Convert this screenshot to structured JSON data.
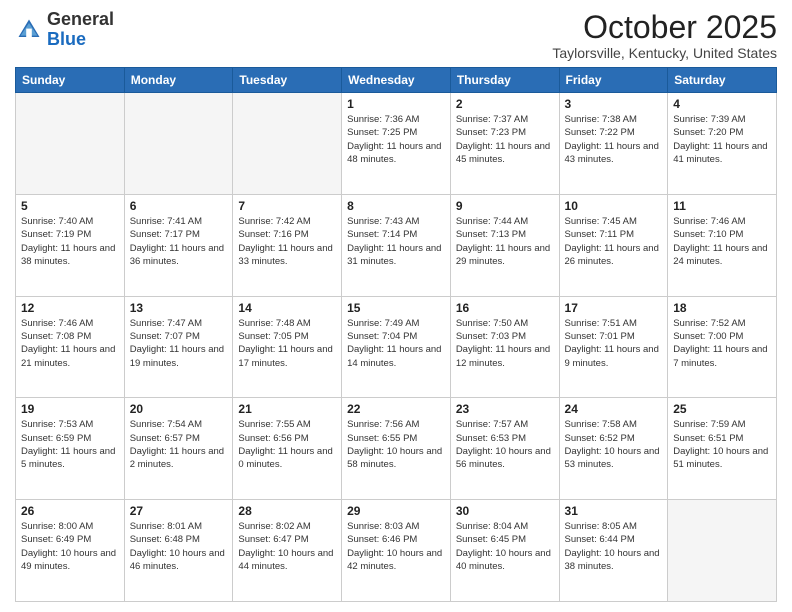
{
  "header": {
    "logo": {
      "general": "General",
      "blue": "Blue"
    },
    "title": "October 2025",
    "location": "Taylorsville, Kentucky, United States"
  },
  "weekdays": [
    "Sunday",
    "Monday",
    "Tuesday",
    "Wednesday",
    "Thursday",
    "Friday",
    "Saturday"
  ],
  "weeks": [
    [
      {
        "day": "",
        "info": "",
        "empty": true
      },
      {
        "day": "",
        "info": "",
        "empty": true
      },
      {
        "day": "",
        "info": "",
        "empty": true
      },
      {
        "day": "1",
        "info": "Sunrise: 7:36 AM\nSunset: 7:25 PM\nDaylight: 11 hours\nand 48 minutes."
      },
      {
        "day": "2",
        "info": "Sunrise: 7:37 AM\nSunset: 7:23 PM\nDaylight: 11 hours\nand 45 minutes."
      },
      {
        "day": "3",
        "info": "Sunrise: 7:38 AM\nSunset: 7:22 PM\nDaylight: 11 hours\nand 43 minutes."
      },
      {
        "day": "4",
        "info": "Sunrise: 7:39 AM\nSunset: 7:20 PM\nDaylight: 11 hours\nand 41 minutes."
      }
    ],
    [
      {
        "day": "5",
        "info": "Sunrise: 7:40 AM\nSunset: 7:19 PM\nDaylight: 11 hours\nand 38 minutes."
      },
      {
        "day": "6",
        "info": "Sunrise: 7:41 AM\nSunset: 7:17 PM\nDaylight: 11 hours\nand 36 minutes."
      },
      {
        "day": "7",
        "info": "Sunrise: 7:42 AM\nSunset: 7:16 PM\nDaylight: 11 hours\nand 33 minutes."
      },
      {
        "day": "8",
        "info": "Sunrise: 7:43 AM\nSunset: 7:14 PM\nDaylight: 11 hours\nand 31 minutes."
      },
      {
        "day": "9",
        "info": "Sunrise: 7:44 AM\nSunset: 7:13 PM\nDaylight: 11 hours\nand 29 minutes."
      },
      {
        "day": "10",
        "info": "Sunrise: 7:45 AM\nSunset: 7:11 PM\nDaylight: 11 hours\nand 26 minutes."
      },
      {
        "day": "11",
        "info": "Sunrise: 7:46 AM\nSunset: 7:10 PM\nDaylight: 11 hours\nand 24 minutes."
      }
    ],
    [
      {
        "day": "12",
        "info": "Sunrise: 7:46 AM\nSunset: 7:08 PM\nDaylight: 11 hours\nand 21 minutes."
      },
      {
        "day": "13",
        "info": "Sunrise: 7:47 AM\nSunset: 7:07 PM\nDaylight: 11 hours\nand 19 minutes."
      },
      {
        "day": "14",
        "info": "Sunrise: 7:48 AM\nSunset: 7:05 PM\nDaylight: 11 hours\nand 17 minutes."
      },
      {
        "day": "15",
        "info": "Sunrise: 7:49 AM\nSunset: 7:04 PM\nDaylight: 11 hours\nand 14 minutes."
      },
      {
        "day": "16",
        "info": "Sunrise: 7:50 AM\nSunset: 7:03 PM\nDaylight: 11 hours\nand 12 minutes."
      },
      {
        "day": "17",
        "info": "Sunrise: 7:51 AM\nSunset: 7:01 PM\nDaylight: 11 hours\nand 9 minutes."
      },
      {
        "day": "18",
        "info": "Sunrise: 7:52 AM\nSunset: 7:00 PM\nDaylight: 11 hours\nand 7 minutes."
      }
    ],
    [
      {
        "day": "19",
        "info": "Sunrise: 7:53 AM\nSunset: 6:59 PM\nDaylight: 11 hours\nand 5 minutes."
      },
      {
        "day": "20",
        "info": "Sunrise: 7:54 AM\nSunset: 6:57 PM\nDaylight: 11 hours\nand 2 minutes."
      },
      {
        "day": "21",
        "info": "Sunrise: 7:55 AM\nSunset: 6:56 PM\nDaylight: 11 hours\nand 0 minutes."
      },
      {
        "day": "22",
        "info": "Sunrise: 7:56 AM\nSunset: 6:55 PM\nDaylight: 10 hours\nand 58 minutes."
      },
      {
        "day": "23",
        "info": "Sunrise: 7:57 AM\nSunset: 6:53 PM\nDaylight: 10 hours\nand 56 minutes."
      },
      {
        "day": "24",
        "info": "Sunrise: 7:58 AM\nSunset: 6:52 PM\nDaylight: 10 hours\nand 53 minutes."
      },
      {
        "day": "25",
        "info": "Sunrise: 7:59 AM\nSunset: 6:51 PM\nDaylight: 10 hours\nand 51 minutes."
      }
    ],
    [
      {
        "day": "26",
        "info": "Sunrise: 8:00 AM\nSunset: 6:49 PM\nDaylight: 10 hours\nand 49 minutes."
      },
      {
        "day": "27",
        "info": "Sunrise: 8:01 AM\nSunset: 6:48 PM\nDaylight: 10 hours\nand 46 minutes."
      },
      {
        "day": "28",
        "info": "Sunrise: 8:02 AM\nSunset: 6:47 PM\nDaylight: 10 hours\nand 44 minutes."
      },
      {
        "day": "29",
        "info": "Sunrise: 8:03 AM\nSunset: 6:46 PM\nDaylight: 10 hours\nand 42 minutes."
      },
      {
        "day": "30",
        "info": "Sunrise: 8:04 AM\nSunset: 6:45 PM\nDaylight: 10 hours\nand 40 minutes."
      },
      {
        "day": "31",
        "info": "Sunrise: 8:05 AM\nSunset: 6:44 PM\nDaylight: 10 hours\nand 38 minutes."
      },
      {
        "day": "",
        "info": "",
        "empty": true
      }
    ]
  ]
}
